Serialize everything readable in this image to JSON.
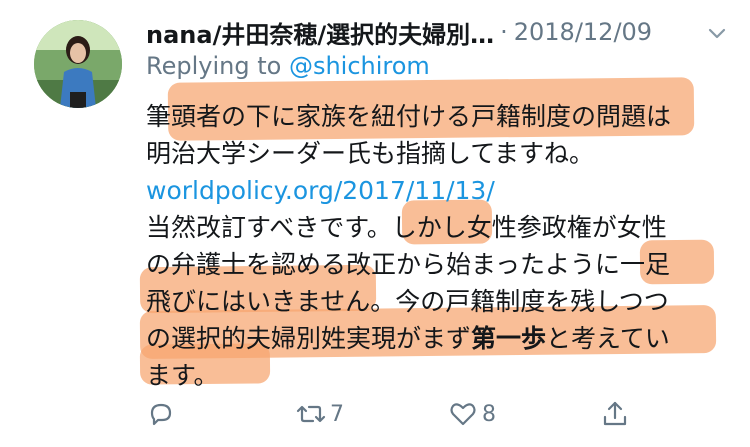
{
  "tweet": {
    "author": "nana/井田奈穂/選択的夫婦別…",
    "separator": "·",
    "date": "2018/12/09",
    "replying_prefix": "Replying to",
    "replying_handle": "@shichirom",
    "lines": [
      "筆頭者の下に家族を紐付ける戸籍制度の問題は",
      "明治大学シーダー氏も指摘してますね。",
      "worldpolicy.org/2017/11/13/",
      "当然改訂すべきです。しかし女性参政権が女性",
      "の弁護士を認める改正から始まったように一足",
      "飛びにはいきません。今の戸籍制度を残しつつ",
      "の選択的夫婦別姓実現がまず",
      "第一歩",
      "と考えてい",
      "ます。"
    ],
    "retweet_count": "7",
    "like_count": "8"
  },
  "icons": {
    "more": "chevron-down-icon",
    "reply": "reply-icon",
    "retweet": "retweet-icon",
    "like": "heart-icon",
    "share": "share-icon"
  },
  "colors": {
    "text": "#14171a",
    "muted": "#657786",
    "link": "#1b95e0",
    "highlight": "#f7a56f"
  }
}
